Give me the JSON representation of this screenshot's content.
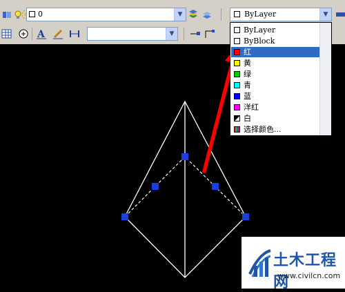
{
  "layer_toolbar": {
    "current_layer": "0"
  },
  "color_combo": {
    "selected": "ByLayer"
  },
  "color_dropdown": {
    "items": [
      {
        "label": "ByLayer",
        "swatch": "#ffffff"
      },
      {
        "label": "ByBlock",
        "swatch": "#ffffff"
      },
      {
        "label": "红",
        "swatch": "#ff0000"
      },
      {
        "label": "黄",
        "swatch": "#ffff00"
      },
      {
        "label": "绿",
        "swatch": "#00cc00"
      },
      {
        "label": "青",
        "swatch": "#00ffff"
      },
      {
        "label": "蓝",
        "swatch": "#0000ff"
      },
      {
        "label": "洋红",
        "swatch": "#ff00ff"
      },
      {
        "label": "白",
        "swatch": "split-black-white"
      },
      {
        "label": "选择颜色...",
        "swatch": "palette"
      }
    ],
    "highlighted_index": 2
  },
  "colors": {
    "toolbar_bg": "#d4d0c8",
    "canvas_bg": "#000000",
    "highlight": "#316ac5",
    "grip": "#1a3fe0",
    "arrow": "#ff0000"
  },
  "watermark": {
    "title": "土木工程网",
    "url": "www.civilcn.com"
  }
}
